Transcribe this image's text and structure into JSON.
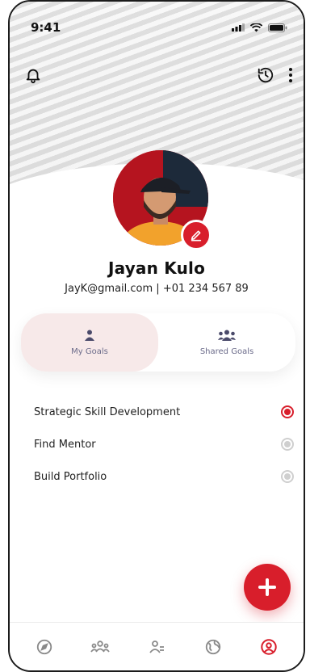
{
  "status_bar": {
    "time": "9:41"
  },
  "profile": {
    "name": "Jayan Kulo",
    "contact": "JayK@gmail.com | +01 234 567 89"
  },
  "tabs": [
    {
      "label": "My Goals",
      "active": true,
      "icon": "person-icon"
    },
    {
      "label": "Shared Goals",
      "active": false,
      "icon": "group-icon"
    }
  ],
  "goals": [
    {
      "label": "Strategic Skill Development",
      "selected": true
    },
    {
      "label": "Find Mentor",
      "selected": false
    },
    {
      "label": "Build Portfolio",
      "selected": false
    }
  ],
  "bottom_nav": [
    {
      "icon": "compass-icon",
      "active": false
    },
    {
      "icon": "people-icon",
      "active": false
    },
    {
      "icon": "user-group-icon",
      "active": false
    },
    {
      "icon": "globe-icon",
      "active": false
    },
    {
      "icon": "profile-icon",
      "active": true
    }
  ],
  "colors": {
    "accent": "#d81e2b",
    "inactive_icon": "#8a8a8a",
    "tab_active_bg": "#f7e9e9"
  }
}
